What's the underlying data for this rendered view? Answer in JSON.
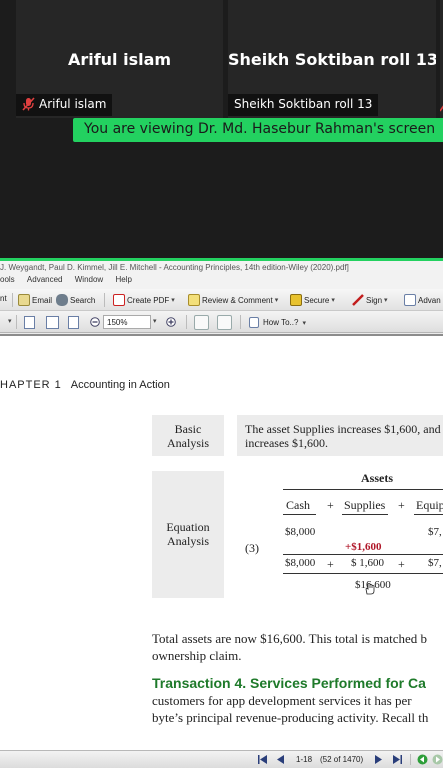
{
  "call": {
    "participants": [
      {
        "display_name": "Ariful islam",
        "label": "Ariful islam",
        "muted": true
      },
      {
        "display_name": "Sheikh Soktiban roll 13",
        "label": "Sheikh Soktiban roll 13",
        "muted": false
      }
    ],
    "banner": "You are viewing Dr. Md. Hasebur Rahman's screen",
    "accent_color": "#23d160"
  },
  "acrobat": {
    "window_title": "J. Weygandt, Paul D. Kimmel, Jill E. Mitchell - Accounting Principles, 14th edition-Wiley (2020).pdf]",
    "menu": [
      "ools",
      "Advanced",
      "Window",
      "Help"
    ],
    "toolbar": {
      "print": "nt",
      "email": "Email",
      "search": "Search",
      "create_pdf": "Create PDF",
      "review": "Review & Comment",
      "secure": "Secure",
      "sign": "Sign",
      "advanced": "Advan"
    },
    "zoom": "150%",
    "how_to": "How To..?",
    "status": {
      "page_label": "1-18",
      "page_info": "(52 of 1470)"
    }
  },
  "document": {
    "chapter_number": "HAPTER 1",
    "chapter_title": "Accounting in Action",
    "basic_analysis_label": [
      "Basic",
      "Analysis"
    ],
    "basic_analysis_text": [
      "The asset Supplies increases $1,600, and",
      "increases $1,600."
    ],
    "equation_label": [
      "Equation",
      "Analysis"
    ],
    "equation": {
      "assets_header": "Assets",
      "row_marker": "(3)",
      "columns": [
        "Cash",
        "+",
        "Supplies",
        "+",
        "Equip"
      ],
      "prior_cash": "$8,000",
      "prior_equip": "$7,",
      "change_supplies": "+$1,600",
      "new_cash": "$8,000",
      "plus": "+",
      "new_supplies": "$ 1,600",
      "new_equip": "$7,",
      "total": "$16,600"
    },
    "paragraph1": [
      "Total assets are now $16,600. This total is matched b",
      "ownership claim."
    ],
    "heading": "Transaction 4.  Services Performed for Ca",
    "paragraph2": [
      "customers for app development services it has per",
      "byte’s principal revenue-producing activity. Recall th"
    ]
  }
}
